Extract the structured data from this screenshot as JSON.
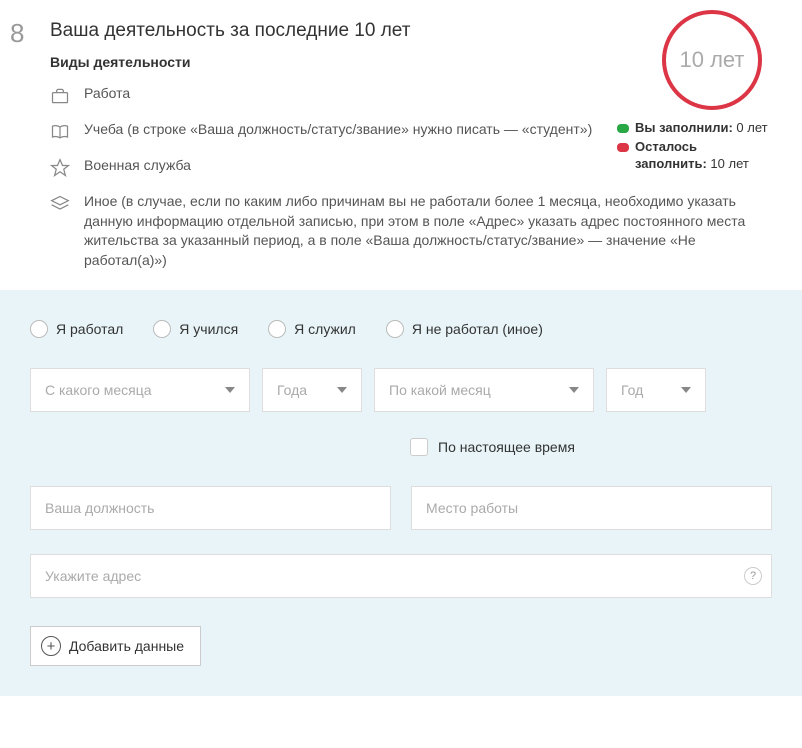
{
  "step_number": "8",
  "section_title": "Ваша деятельность за последние 10 лет",
  "subsection_title": "Виды деятельности",
  "circle_badge": "10 лет",
  "status": {
    "filled_label": "Вы заполнили:",
    "filled_value": "0 лет",
    "remaining_label": "Осталось заполнить:",
    "remaining_value": "10 лет"
  },
  "activities": {
    "work": "Работа",
    "study": "Учеба (в строке «Ваша должность/статус/звание» нужно писать — «студент»)",
    "military": "Военная служба",
    "other": "Иное (в случае, если по каким либо причинам вы не работали более 1 месяца, необходимо указать данную информацию отдельной записью, при этом в поле «Адрес» указать адрес постоянного места жительства за указанный период, а в поле «Ваша должность/статус/звание» — значение «Не работал(а)»)"
  },
  "radios": {
    "worked": "Я работал",
    "studied": "Я учился",
    "served": "Я служил",
    "none": "Я не работал (иное)"
  },
  "selects": {
    "from_month": "С какого месяца",
    "from_year": "Года",
    "to_month": "По какой месяц",
    "to_year": "Год"
  },
  "checkbox_present": "По настоящее время",
  "inputs": {
    "position": "Ваша должность",
    "workplace": "Место работы",
    "address": "Укажите адрес"
  },
  "help_symbol": "?",
  "add_button": "Добавить данные"
}
